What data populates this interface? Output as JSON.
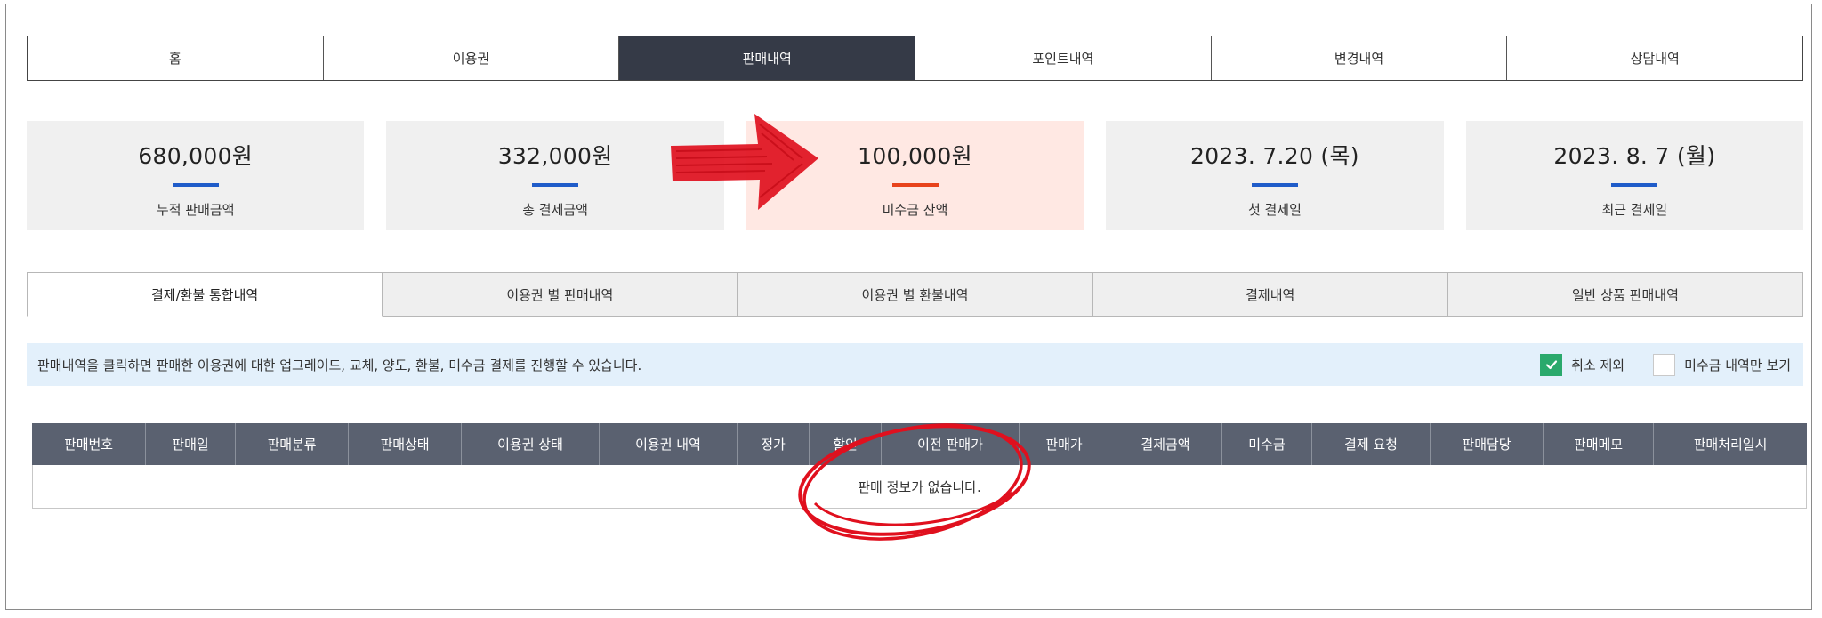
{
  "top_nav": {
    "tabs": [
      {
        "label": "홈",
        "active": false
      },
      {
        "label": "이용권",
        "active": false
      },
      {
        "label": "판매내역",
        "active": true
      },
      {
        "label": "포인트내역",
        "active": false
      },
      {
        "label": "변경내역",
        "active": false
      },
      {
        "label": "상담내역",
        "active": false
      }
    ]
  },
  "stats": [
    {
      "value": "680,000원",
      "label": "누적 판매금액"
    },
    {
      "value": "332,000원",
      "label": "총 결제금액"
    },
    {
      "value": "100,000원",
      "label": "미수금 잔액"
    },
    {
      "value": "2023. 7.20 (목)",
      "label": "첫 결제일"
    },
    {
      "value": "2023. 8. 7 (월)",
      "label": "최근 결제일"
    }
  ],
  "sub_tabs": [
    {
      "label": "결제/환불 통합내역",
      "active": true
    },
    {
      "label": "이용권 별 판매내역",
      "active": false
    },
    {
      "label": "이용권 별 환불내역",
      "active": false
    },
    {
      "label": "결제내역",
      "active": false
    },
    {
      "label": "일반 상품 판매내역",
      "active": false
    }
  ],
  "info_bar": {
    "message": "판매내역을 클릭하면 판매한 이용권에 대한 업그레이드, 교체, 양도, 환불, 미수금 결제를 진행할 수 있습니다.",
    "exclude_cancel": {
      "label": "취소 제외",
      "checked": true
    },
    "unpaid_only": {
      "label": "미수금 내역만 보기",
      "checked": false
    }
  },
  "table": {
    "headers": [
      "판매번호",
      "판매일",
      "판매분류",
      "판매상태",
      "이용권 상태",
      "이용권 내역",
      "정가",
      "할인",
      "이전 판매가",
      "판매가",
      "결제금액",
      "미수금",
      "결제 요청",
      "판매담당",
      "판매메모",
      "판매처리일시"
    ],
    "empty_message": "판매 정보가 없습니다."
  },
  "colors": {
    "nav_active": "#353a47",
    "accent_blue": "#1f5cc9",
    "accent_red": "#e8431c",
    "highlight_card": "#ffe8e3",
    "info_bg": "#e3f0fb",
    "check_green": "#2aa96c",
    "table_header": "#5a6170",
    "annotation_red": "#e0101e"
  }
}
